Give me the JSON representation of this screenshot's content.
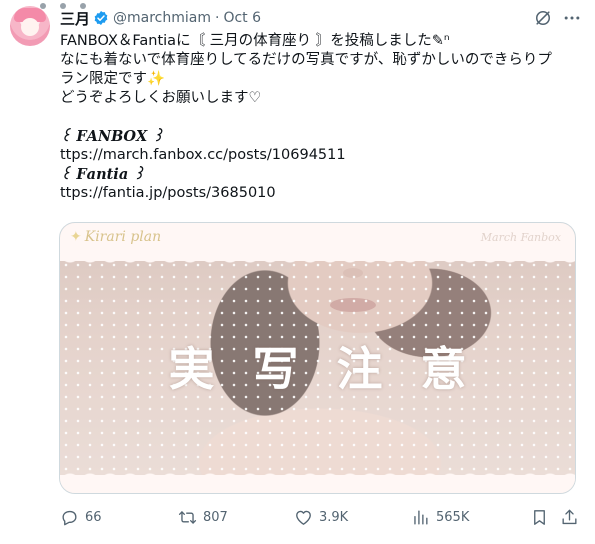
{
  "tweet": {
    "author_name": "三月",
    "handle": "@marchmiam",
    "separator": "·",
    "date": "Oct 6",
    "verified_color": "#1d9bf0",
    "lines": [
      "FANBOX＆Fantiaに〘 三月の体育座り 〙を投稿しました✎︎ⁿ",
      "なにも着ないで体育座りしてるだけの写真ですが、恥ずかしいのできらりプ",
      "ラン限定です✨",
      "どうぞよろしくお願いします♡"
    ],
    "fanbox_label": "꒰ 𝑭𝑨𝑵𝑩𝑶𝑿 ꒱",
    "fanbox_link": "ttps://march.fanbox.cc/posts/10694511",
    "fantia_label": "꒰ 𝑭𝒂𝒏𝒕𝒊𝒂 ꒱",
    "fantia_link": "ttps://fantia.jp/posts/3685010"
  },
  "media": {
    "brand_text": "Kirari plan",
    "brand_right": "March Fanbox",
    "warning_text": "実写注意"
  },
  "actions": {
    "replies": "66",
    "reposts": "807",
    "likes": "3.9K",
    "views": "565K"
  },
  "icons": [
    "verified-icon",
    "grok-icon",
    "more-icon",
    "reply-icon",
    "repost-icon",
    "like-icon",
    "views-icon",
    "bookmark-icon",
    "share-icon"
  ]
}
